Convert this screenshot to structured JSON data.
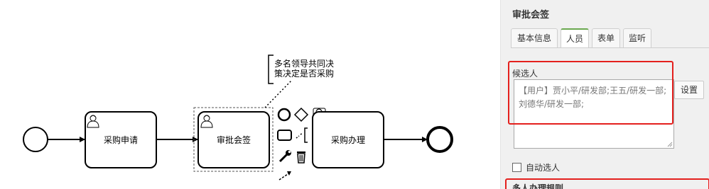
{
  "diagram": {
    "tasks": [
      {
        "label": "采购申请"
      },
      {
        "label": "审批会签"
      },
      {
        "label": "采购办理"
      }
    ],
    "annotation": [
      "多名领导共同决",
      "策决定是否采购"
    ]
  },
  "panel": {
    "title": "审批会签",
    "tabs": [
      {
        "label": "基本信息",
        "active": false
      },
      {
        "label": "人员",
        "active": true
      },
      {
        "label": "表单",
        "active": false
      },
      {
        "label": "监听",
        "active": false
      }
    ],
    "candidate_label": "候选人",
    "candidate_value": "【用户】贾小平/研发部;王五/研发一部;刘德华/研发一部;",
    "set_button": "设置",
    "auto_select_label": "自动选人",
    "multi_rule_label": "多人办理规则",
    "highlight_color": "#e4201d",
    "active_tab_color": "#6aa84f"
  }
}
